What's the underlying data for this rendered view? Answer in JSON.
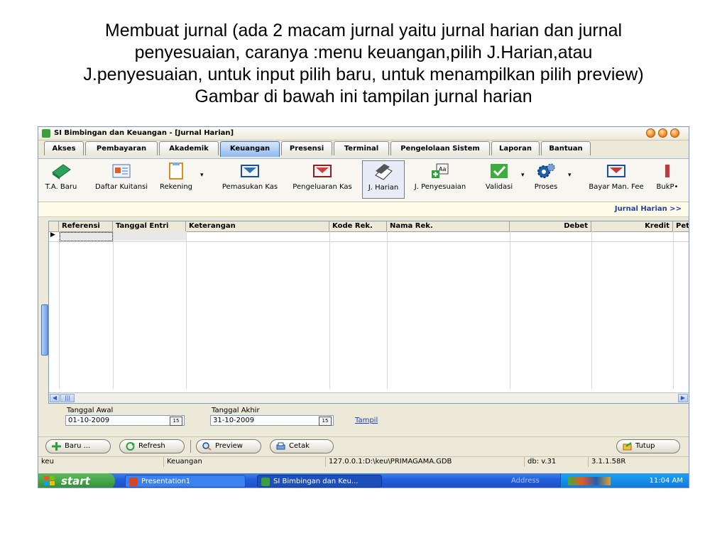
{
  "caption": {
    "line1": "Membuat jurnal (ada 2 macam jurnal yaitu jurnal harian dan jurnal",
    "line2": "penyesuaian, caranya :menu keuangan,pilih J.Harian,atau",
    "line3": "J.penyesuaian, untuk input pilih baru, untuk menampilkan pilih preview)",
    "line4": "Gambar di bawah ini tampilan jurnal harian"
  },
  "window": {
    "title": "SI Bimbingan dan Keuangan - [Jurnal Harian]"
  },
  "tabs": [
    "Akses",
    "Pembayaran",
    "Akademik",
    "Keuangan",
    "Presensi",
    "Terminal",
    "Pengelolaan Sistem",
    "Laporan",
    "Bantuan"
  ],
  "active_tab": "Keuangan",
  "toolbar": {
    "ta_baru": "T.A. Baru",
    "daftar_kuitansi": "Daftar Kuitansi",
    "rekening": "Rekening",
    "pemasukan_kas": "Pemasukan Kas",
    "pengeluaran_kas": "Pengeluaran Kas",
    "j_harian": "J. Harian",
    "j_penyesuaian": "J. Penyesuaian",
    "validasi": "Validasi",
    "proses": "Proses",
    "bayar_man_fee": "Bayar Man. Fee",
    "bukp": "BukP•"
  },
  "section_title": "Jurnal Harian >>",
  "grid": {
    "columns": [
      "Referensi",
      "Tanggal Entri",
      "Keterangan",
      "Kode Rek.",
      "Nama Rek.",
      "Debet",
      "Kredit",
      "Pet"
    ]
  },
  "filter": {
    "tanggal_awal_label": "Tanggal Awal",
    "tanggal_awal_value": "01-10-2009",
    "tanggal_akhir_label": "Tanggal Akhir",
    "tanggal_akhir_value": "31-10-2009",
    "calendar_label": "15",
    "tampil": "Tampil"
  },
  "buttons": {
    "baru": "Baru ...",
    "refresh": "Refresh",
    "preview": "Preview",
    "cetak": "Cetak",
    "tutup": "Tutup"
  },
  "statusbar": {
    "user": "keu",
    "module": "Keuangan",
    "database": "127.0.0.1:D:\\keu\\PRIMAGAMA.GDB",
    "db_version": "db: v.31",
    "app_version": "3.1.1.58R"
  },
  "taskbar": {
    "start": "start",
    "task1": "Presentation1",
    "task2": "SI Bimbingan dan Keu...",
    "address": "Address",
    "clock": "11:04 AM"
  },
  "colors": {
    "accent": "#3a6fc4",
    "taskbar": "#245edb",
    "start_green": "#2f8f2f"
  }
}
